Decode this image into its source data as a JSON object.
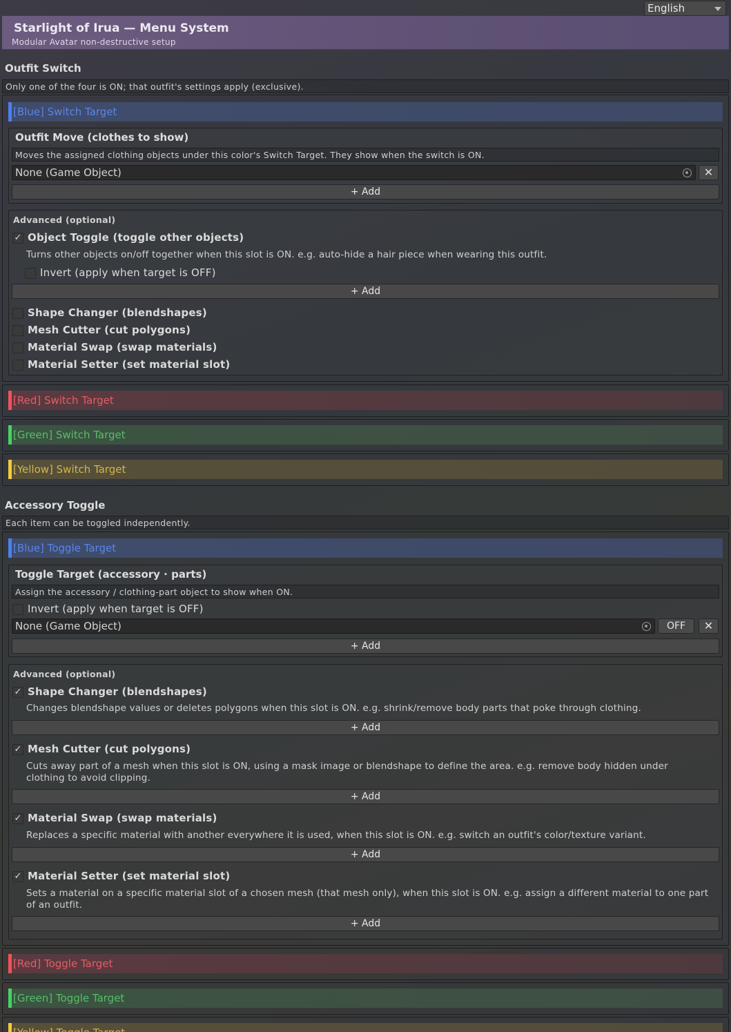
{
  "language": {
    "selected": "English"
  },
  "header": {
    "title": "Starlight of Irua — Menu System",
    "subtitle": "Modular Avatar non-destructive setup"
  },
  "outfit_switch": {
    "title": "Outfit Switch",
    "help": "Only one of the four is ON; that outfit's settings apply (exclusive).",
    "targets": {
      "blue": "[Blue] Switch Target",
      "red": "[Red] Switch Target",
      "green": "[Green] Switch Target",
      "yellow": "[Yellow] Switch Target"
    },
    "outfit_move": {
      "title": "Outfit Move  (clothes to show)",
      "help": "Moves the assigned clothing objects under this color's Switch Target. They show when the switch is ON.",
      "field_value": "None (Game Object)",
      "add_label": "+ Add"
    },
    "advanced": {
      "title": "Advanced (optional)",
      "object_toggle": {
        "label": "Object Toggle  (toggle other objects)",
        "checked": true,
        "description": "Turns other objects on/off together when this slot is ON. e.g. auto-hide a hair piece when wearing this outfit.",
        "invert_label": "Invert  (apply when target is OFF)",
        "add_label": "+ Add"
      },
      "shape_changer": {
        "label": "Shape Changer  (blendshapes)",
        "checked": false
      },
      "mesh_cutter": {
        "label": "Mesh Cutter  (cut polygons)",
        "checked": false
      },
      "material_swap": {
        "label": "Material Swap  (swap materials)",
        "checked": false
      },
      "material_setter": {
        "label": "Material Setter  (set material slot)",
        "checked": false
      }
    }
  },
  "accessory_toggle": {
    "title": "Accessory Toggle",
    "help": "Each item can be toggled independently.",
    "targets": {
      "blue": "[Blue] Toggle Target",
      "red": "[Red] Toggle Target",
      "green": "[Green] Toggle Target",
      "yellow": "[Yellow] Toggle Target"
    },
    "toggle_target": {
      "title": "Toggle Target  (accessory · parts)",
      "help": "Assign the accessory / clothing-part object to show when ON.",
      "invert_label": "Invert  (apply when target is OFF)",
      "field_value": "None (Game Object)",
      "off_label": "OFF",
      "add_label": "+ Add"
    },
    "advanced": {
      "title": "Advanced (optional)",
      "shape_changer": {
        "label": "Shape Changer  (blendshapes)",
        "checked": true,
        "description": "Changes blendshape values or deletes polygons when this slot is ON. e.g. shrink/remove body parts that poke through clothing.",
        "add_label": "+ Add"
      },
      "mesh_cutter": {
        "label": "Mesh Cutter  (cut polygons)",
        "checked": true,
        "description": "Cuts away part of a mesh when this slot is ON, using a mask image or blendshape to define the area. e.g. remove body hidden under clothing to avoid clipping.",
        "add_label": "+ Add"
      },
      "material_swap": {
        "label": "Material Swap  (swap materials)",
        "checked": true,
        "description": "Replaces a specific material with another everywhere it is used, when this slot is ON. e.g. switch an outfit's color/texture variant.",
        "add_label": "+ Add"
      },
      "material_setter": {
        "label": "Material Setter  (set material slot)",
        "checked": true,
        "description": "Sets a material on a specific material slot of a chosen mesh (that mesh only), when this slot is ON. e.g. assign a different material to one part of an outfit.",
        "add_label": "+ Add"
      }
    }
  },
  "colors": {
    "blue": "#4d7ff0",
    "red": "#f0525a",
    "green": "#47d265",
    "yellow": "#f2cb3a",
    "header": "#6c5c80"
  },
  "icons": {
    "object_picker": "target-icon",
    "remove": "close-icon",
    "dropdown": "chevron-down-icon",
    "check": "checkmark-icon"
  }
}
